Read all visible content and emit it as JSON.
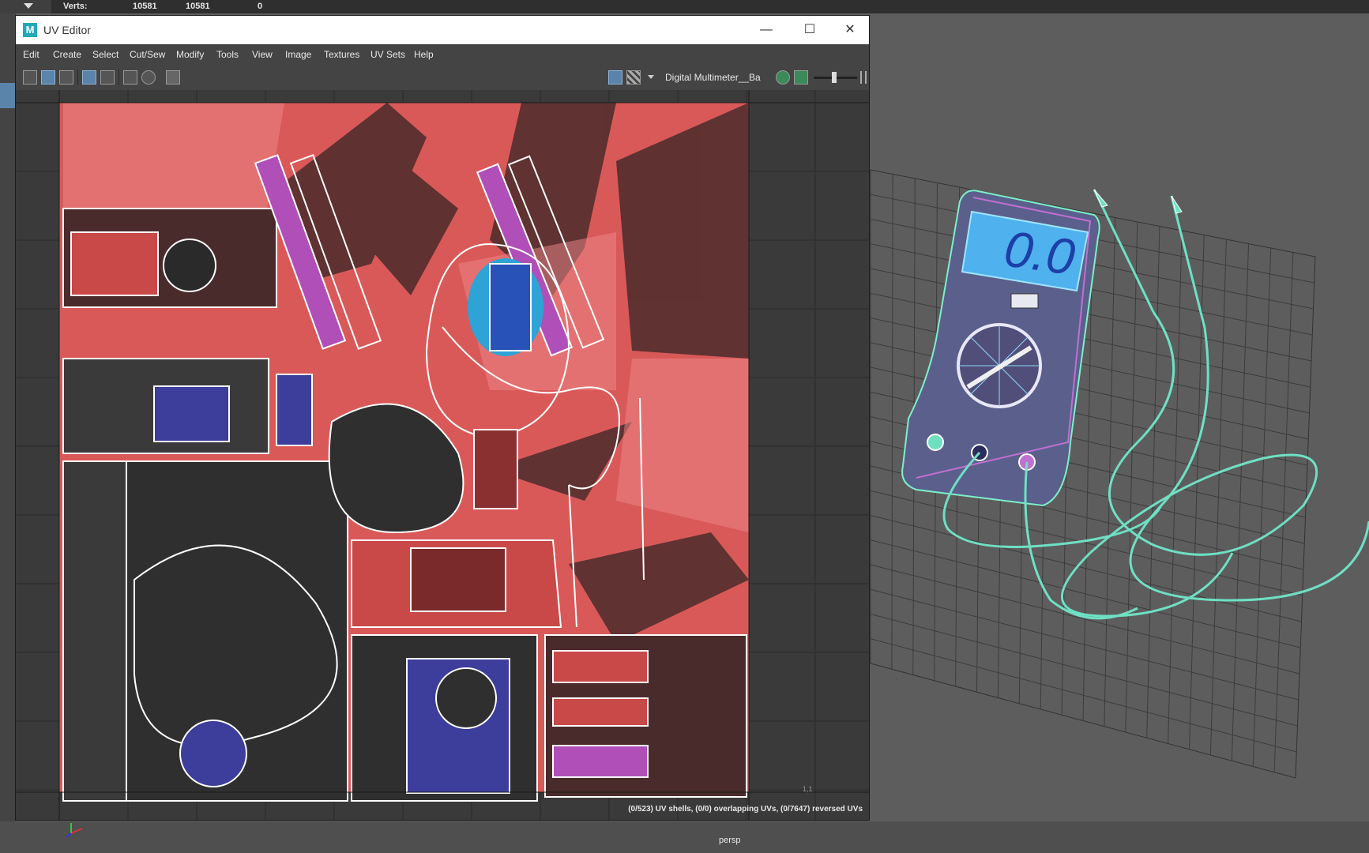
{
  "hud": {
    "label": "Verts:",
    "values": [
      "10581",
      "10581",
      "0"
    ]
  },
  "uv_editor": {
    "title": "UV Editor",
    "logo_letter": "M",
    "window_controls": {
      "minimize": "—",
      "maximize": "☐",
      "close": "✕"
    },
    "menu": [
      "Edit",
      "Create",
      "Select",
      "Cut/Sew",
      "Modify",
      "Tools",
      "View",
      "Image",
      "Textures",
      "UV Sets",
      "Help"
    ],
    "texture_name": "Digital Multimeter__Ba",
    "status_text": "(0/523) UV shells, (0/0) overlapping UVs, (0/7647) reversed UVs",
    "corner_label": "1,1"
  },
  "viewport": {
    "camera": "persp"
  },
  "colors": {
    "uv_texture": "#d95959",
    "uv_wire": "#ffffff",
    "lcd_blue": "#3fa8e8",
    "wire_green": "#6fe0c4",
    "select_blue": "#5a84aa"
  },
  "icons": [
    "dropdown-arrow-icon",
    "maya-logo-icon",
    "minimize-icon",
    "maximize-icon",
    "close-icon",
    "camera-icon",
    "checker-icon",
    "image-icon",
    "grid-icon",
    "axis-gizmo-icon"
  ]
}
